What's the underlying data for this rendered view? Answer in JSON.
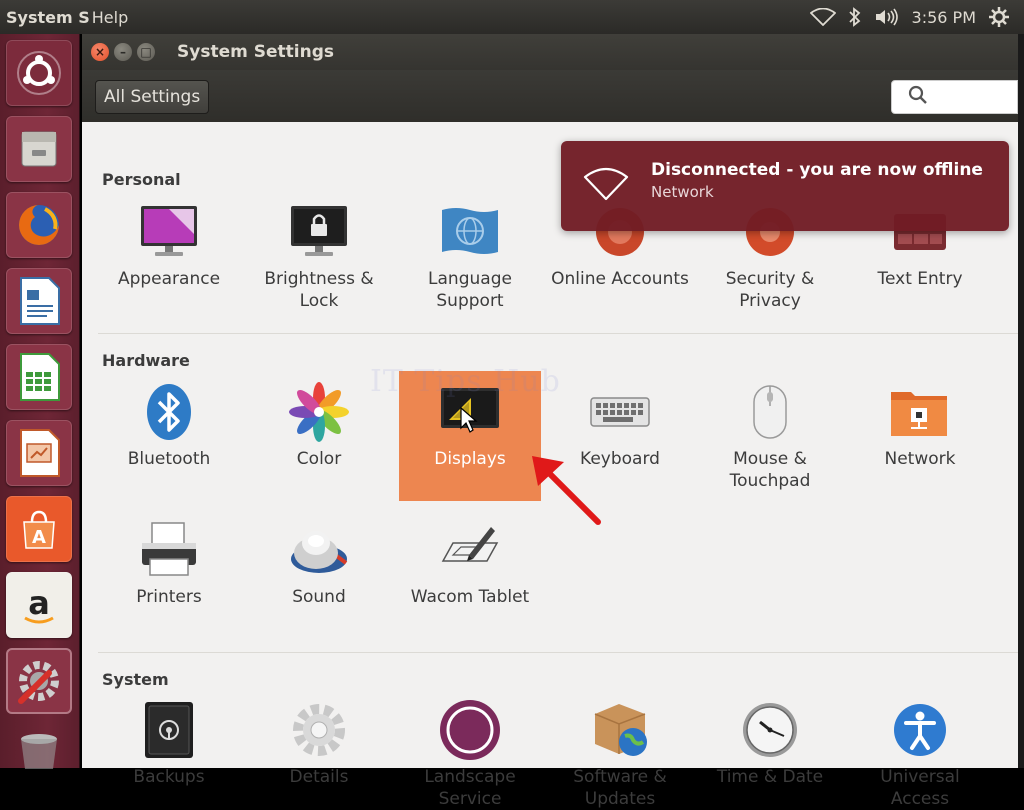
{
  "top_panel": {
    "app_menu": "System S",
    "help_menu": "Help",
    "clock": "3:56 PM"
  },
  "window": {
    "title": "System Settings",
    "all_settings_label": "All Settings",
    "search_placeholder": ""
  },
  "sections": {
    "personal": {
      "title": "Personal",
      "items": [
        {
          "label": "Appearance",
          "icon": "appearance-icon"
        },
        {
          "label": "Brightness & Lock",
          "icon": "brightness-lock-icon"
        },
        {
          "label": "Language Support",
          "icon": "language-support-icon"
        },
        {
          "label": "Online Accounts",
          "icon": "online-accounts-icon"
        },
        {
          "label": "Security & Privacy",
          "icon": "security-privacy-icon"
        },
        {
          "label": "Text Entry",
          "icon": "text-entry-icon"
        }
      ]
    },
    "hardware": {
      "title": "Hardware",
      "items": [
        {
          "label": "Bluetooth",
          "icon": "bluetooth-icon"
        },
        {
          "label": "Color",
          "icon": "color-icon"
        },
        {
          "label": "Displays",
          "icon": "displays-icon"
        },
        {
          "label": "Keyboard",
          "icon": "keyboard-icon"
        },
        {
          "label": "Mouse & Touchpad",
          "icon": "mouse-icon"
        },
        {
          "label": "Network",
          "icon": "network-icon"
        },
        {
          "label": "Printers",
          "icon": "printer-icon"
        },
        {
          "label": "Sound",
          "icon": "sound-icon"
        },
        {
          "label": "Wacom Tablet",
          "icon": "wacom-tablet-icon"
        }
      ]
    },
    "system": {
      "title": "System",
      "items": [
        {
          "label": "Backups",
          "icon": "backups-icon"
        },
        {
          "label": "Details",
          "icon": "details-icon"
        },
        {
          "label": "Landscape Service",
          "icon": "landscape-icon"
        },
        {
          "label": "Software & Updates",
          "icon": "software-updates-icon"
        },
        {
          "label": "Time & Date",
          "icon": "clock-icon"
        },
        {
          "label": "Universal Access",
          "icon": "universal-access-icon"
        }
      ]
    }
  },
  "notification": {
    "title": "Disconnected - you are now offline",
    "body": "Network"
  },
  "selected_item": "Displays",
  "colors": {
    "launcher": "#6e2636",
    "selection": "#ed8650",
    "notification": "#701c24",
    "annotation_arrow": "#e01919"
  },
  "launcher": [
    "dash-home-icon",
    "files-icon",
    "firefox-icon",
    "writer-icon",
    "calc-icon",
    "impress-icon",
    "software-center-icon",
    "amazon-icon",
    "system-settings-icon",
    "trash-icon"
  ],
  "watermark": "IT Tips Hub"
}
